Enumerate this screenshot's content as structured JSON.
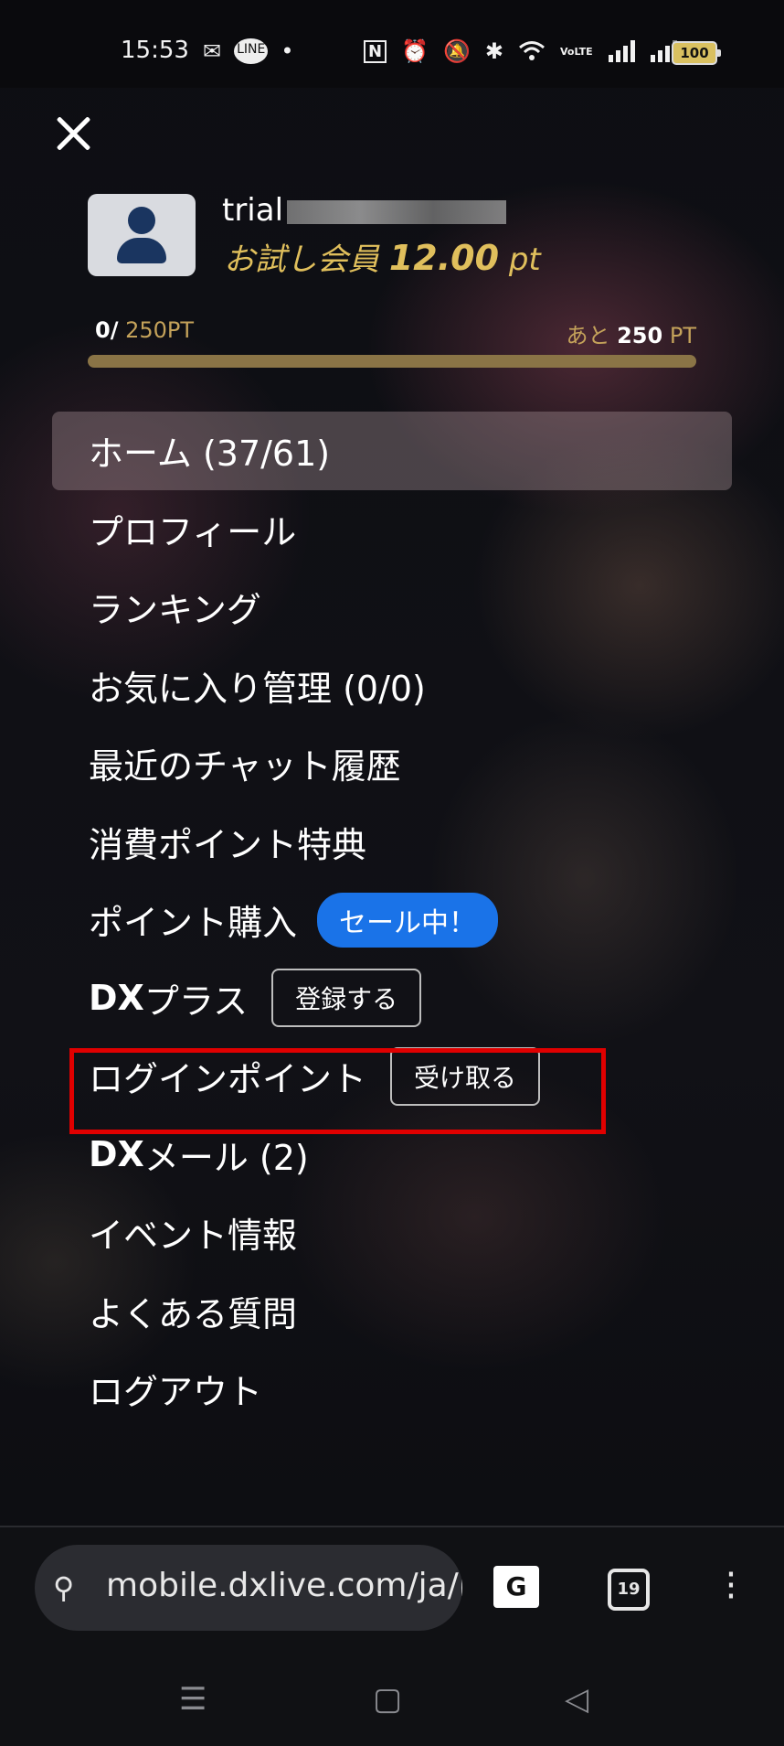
{
  "status": {
    "time": "15:53",
    "left_icons": [
      "✉",
      "LINE",
      "•"
    ],
    "right_icons": [
      "N",
      "⏰",
      "🔕",
      "✱",
      "WiFi",
      "VoLTE",
      "signal",
      "signal"
    ],
    "battery": "100"
  },
  "user": {
    "name": "trial",
    "rank_label": "お試し会員",
    "points": "12.00",
    "points_unit": "pt"
  },
  "progress": {
    "current": "0/",
    "target": "250PT",
    "remaining_prefix": "あと",
    "remaining": "250",
    "remaining_unit": "PT",
    "fraction": 0.0
  },
  "menu": {
    "home": "ホーム (37/61)",
    "profile": "プロフィール",
    "ranking": "ランキング",
    "favorites": "お気に入り管理 (0/0)",
    "chat_history": "最近のチャット履歴",
    "point_benefits": "消費ポイント特典",
    "buy_points": "ポイント購入",
    "sale_badge": "セール中！",
    "dx_plus_strong": "DX",
    "dx_plus_rest": "プラス",
    "register_btn": "登録する",
    "login_points": "ログインポイント",
    "receive_btn": "受け取る",
    "dx_mail_strong": "DX",
    "dx_mail_rest": "メール (2)",
    "events": "イベント情報",
    "faq": "よくある質問",
    "logout": "ログアウト"
  },
  "browser": {
    "url": "mobile.dxlive.com/ja/h",
    "tab_count": "19"
  },
  "colors": {
    "gold": "#e0bf5c",
    "sale_blue": "#1a73e8",
    "highlight_red": "#e00000"
  }
}
